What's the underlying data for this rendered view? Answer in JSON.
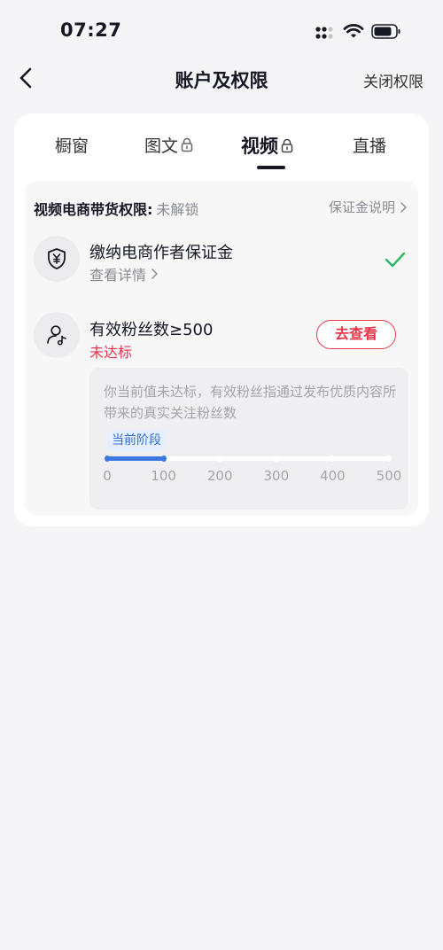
{
  "status_bar": {
    "time": "07:27"
  },
  "nav": {
    "title": "账户及权限",
    "right_action": "关闭权限"
  },
  "tabs": [
    {
      "label": "橱窗",
      "locked": false,
      "active": false
    },
    {
      "label": "图文",
      "locked": true,
      "active": false
    },
    {
      "label": "视频",
      "locked": true,
      "active": true
    },
    {
      "label": "直播",
      "locked": false,
      "active": false
    }
  ],
  "permission": {
    "label": "视频电商带货权限:",
    "status": "未解锁",
    "help_link": "保证金说明"
  },
  "deposit_item": {
    "title": "缴纳电商作者保证金",
    "link": "查看详情",
    "completed": true
  },
  "fans_item": {
    "title": "有效粉丝数≥500",
    "status": "未达标",
    "button": "去查看",
    "info": "你当前值未达标，有效粉丝指通过发布优质内容所带来的真实关注粉丝数",
    "stage_tag": "当前阶段",
    "progress_ticks": [
      "0",
      "100",
      "200",
      "300",
      "400",
      "500"
    ],
    "progress_fraction": 0.2
  },
  "colors": {
    "accent_red": "#e8354a",
    "progress_blue": "#3b79e0",
    "check_green": "#2ab865"
  },
  "icons": {
    "deposit": "shield-yen-icon",
    "fans": "user-music-icon",
    "done": "check-icon"
  }
}
